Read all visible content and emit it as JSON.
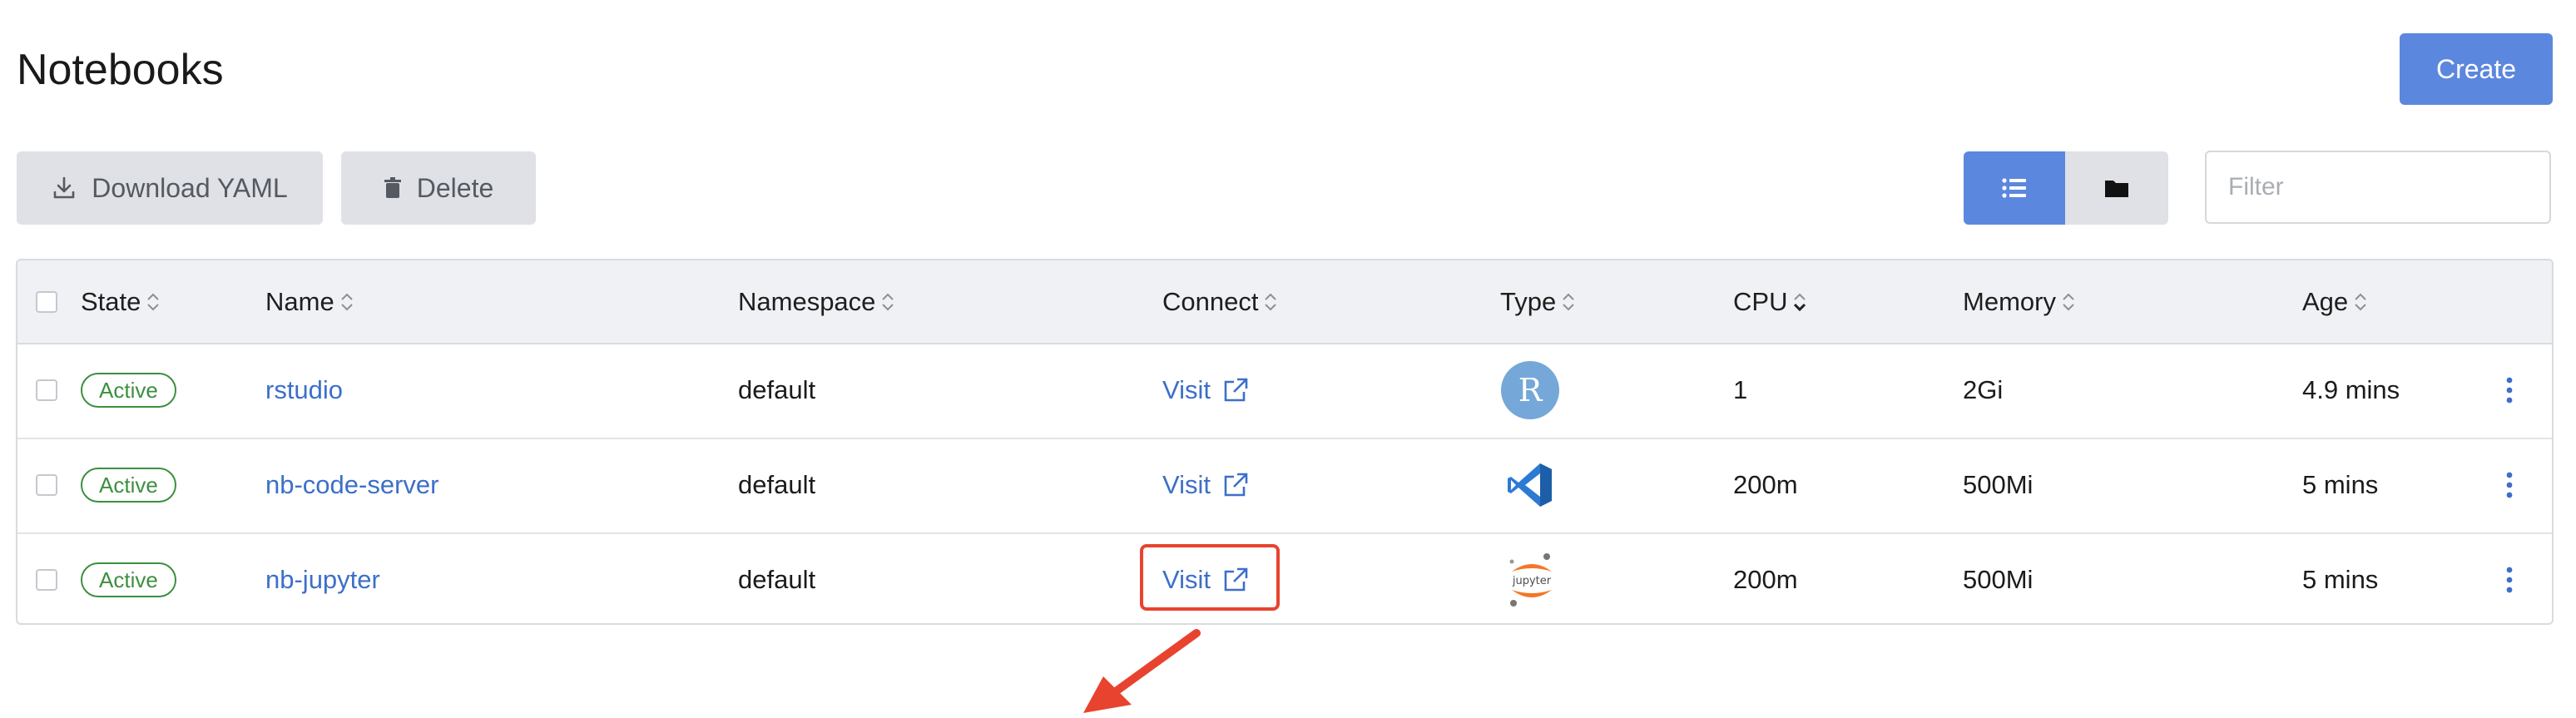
{
  "page": {
    "title": "Notebooks"
  },
  "toolbar": {
    "create_label": "Create",
    "download_label": "Download YAML",
    "delete_label": "Delete",
    "filter_placeholder": "Filter"
  },
  "table": {
    "columns": [
      "State",
      "Name",
      "Namespace",
      "Connect",
      "Type",
      "CPU",
      "Memory",
      "Age"
    ],
    "rows": [
      {
        "state": "Active",
        "name": "rstudio",
        "namespace": "default",
        "connect": "Visit",
        "type": "rstudio-icon",
        "cpu": "1",
        "memory": "2Gi",
        "age": "4.9 mins"
      },
      {
        "state": "Active",
        "name": "nb-code-server",
        "namespace": "default",
        "connect": "Visit",
        "type": "vscode-icon",
        "cpu": "200m",
        "memory": "500Mi",
        "age": "5 mins"
      },
      {
        "state": "Active",
        "name": "nb-jupyter",
        "namespace": "default",
        "connect": "Visit",
        "type": "jupyter-icon",
        "cpu": "200m",
        "memory": "500Mi",
        "age": "5 mins"
      }
    ]
  },
  "colors": {
    "primary": "#5b87de",
    "link": "#3d6fc9",
    "active_green": "#3d8f3f",
    "annotation_red": "#e8432e"
  },
  "icons": {
    "rstudio_letter": "R",
    "jupyter_wordmark": "jupyter"
  }
}
